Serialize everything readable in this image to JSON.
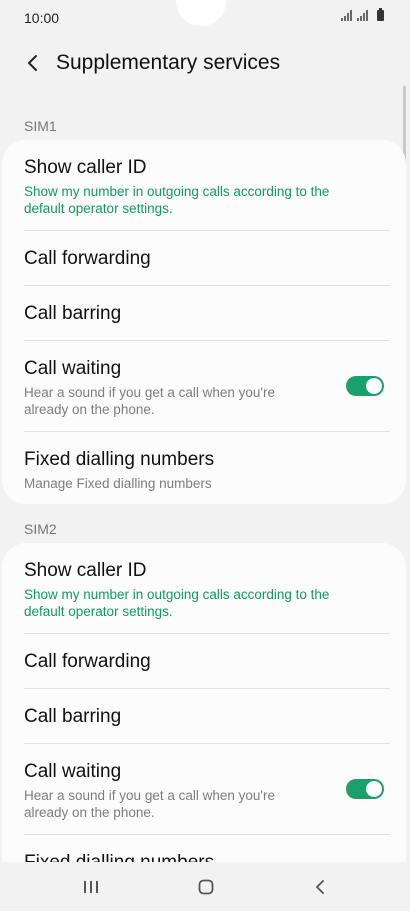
{
  "status": {
    "time": "10:00",
    "icons": [
      "signal-icon",
      "signal-icon",
      "battery-icon"
    ]
  },
  "header": {
    "title": "Supplementary services",
    "back_icon": "back-arrow-icon"
  },
  "sim1": {
    "label": "SIM1",
    "show_caller_id": {
      "title": "Show caller ID",
      "subtitle": "Show my number in outgoing calls according to the default operator settings."
    },
    "call_forwarding": {
      "title": "Call forwarding"
    },
    "call_barring": {
      "title": "Call barring"
    },
    "call_waiting": {
      "title": "Call waiting",
      "subtitle": "Hear a sound if you get a call when you're already on the phone.",
      "toggle_on": true
    },
    "fdn": {
      "title": "Fixed dialling numbers",
      "subtitle": "Manage Fixed dialling numbers"
    }
  },
  "sim2": {
    "label": "SIM2",
    "show_caller_id": {
      "title": "Show caller ID",
      "subtitle": "Show my number in outgoing calls according to the default operator settings."
    },
    "call_forwarding": {
      "title": "Call forwarding"
    },
    "call_barring": {
      "title": "Call barring"
    },
    "call_waiting": {
      "title": "Call waiting",
      "subtitle": "Hear a sound if you get a call when you're already on the phone.",
      "toggle_on": true
    },
    "fdn": {
      "title": "Fixed dialling numbers"
    }
  },
  "nav": {
    "icons": [
      "recent-apps-icon",
      "home-icon",
      "back-icon"
    ]
  },
  "colors": {
    "accent": "#1aa06a",
    "accent_text": "#0e9b5e",
    "background": "#f2f2f2",
    "card": "#fcfcfc"
  }
}
